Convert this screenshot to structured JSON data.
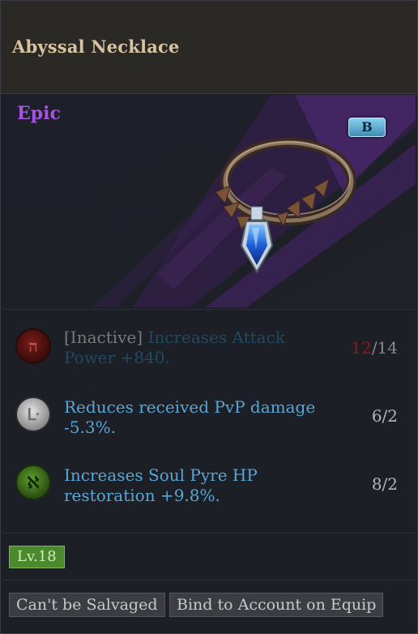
{
  "item": {
    "name": "Abyssal Necklace",
    "grade": "Epic",
    "bind_badge": "B",
    "level": "Lv.18"
  },
  "effects": [
    {
      "rune_icon": "red-rune-icon",
      "rune_glyph": "ה",
      "status": "[Inactive]",
      "text": "Increases Attack Power +840.",
      "value_current": "12",
      "value_sep": "/14",
      "color": "#1f4a62"
    },
    {
      "rune_icon": "white-rune-icon",
      "rune_glyph": "ᒷ",
      "status": "",
      "text": "Reduces received PvP damage -5.3%.",
      "value": "6/2",
      "color": "#5aa6d6"
    },
    {
      "rune_icon": "green-rune-icon",
      "rune_glyph": "ℵ",
      "status": "",
      "text": "Increases Soul Pyre HP restoration +9.8%.",
      "value": "8/2",
      "color": "#5aa6d6"
    }
  ],
  "tags": [
    "Can't be Salvaged",
    "Bind to Account on Equip"
  ],
  "colors": {
    "epic": "#a654e0",
    "effect_active": "#5aa6d6",
    "effect_inactive": "#1f4a62",
    "value_deficit": "#8a1d1d"
  }
}
